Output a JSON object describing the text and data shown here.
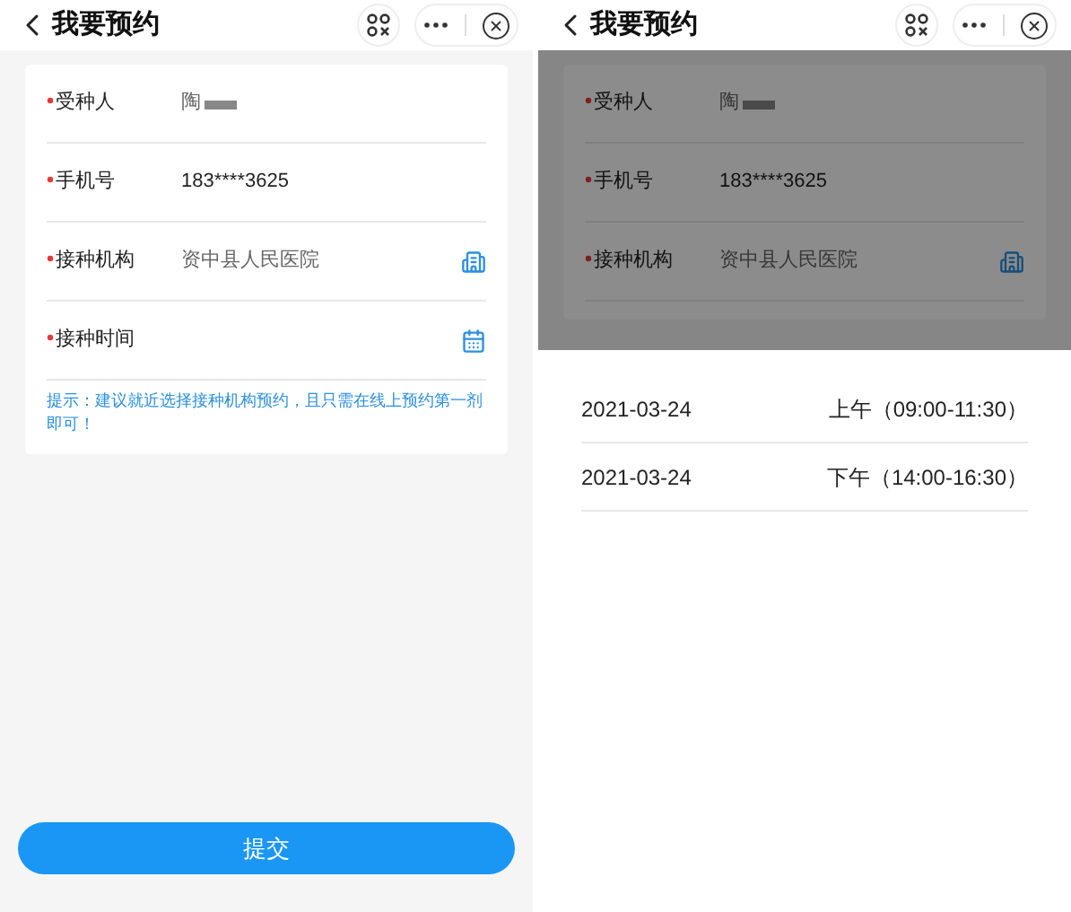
{
  "screens": [
    {
      "header": {
        "title": "我要预约"
      },
      "form": {
        "fields": [
          {
            "label": "受种人",
            "value": "陶",
            "required": true,
            "redacted": true
          },
          {
            "label": "手机号",
            "value": "183****3625",
            "required": true,
            "redacted": false
          },
          {
            "label": "接种机构",
            "value": "资中县人民医院",
            "required": true,
            "redacted": false,
            "kind": "building"
          },
          {
            "label": "接种时间",
            "required": true,
            "redacted": false,
            "kind": "calendar"
          }
        ],
        "hint": "提示：建议就近选择接种机构预约，且只需在线上预约第一剂即可！"
      },
      "submit": "提交"
    },
    {
      "header": {
        "title": "我要预约"
      },
      "form": {
        "fields": [
          {
            "label": "受种人",
            "value": "陶",
            "required": true,
            "redacted": true
          },
          {
            "label": "手机号",
            "value": "183****3625",
            "required": true,
            "redacted": false
          },
          {
            "label": "接种机构",
            "value": "资中县人民医院",
            "required": true,
            "redacted": false,
            "kind": "building"
          }
        ]
      },
      "sheet": {
        "options": [
          {
            "date": "2021-03-24",
            "period": "上午（09:00-11:30）"
          },
          {
            "date": "2021-03-24",
            "period": "下午（14:00-16:30）"
          }
        ]
      }
    }
  ]
}
